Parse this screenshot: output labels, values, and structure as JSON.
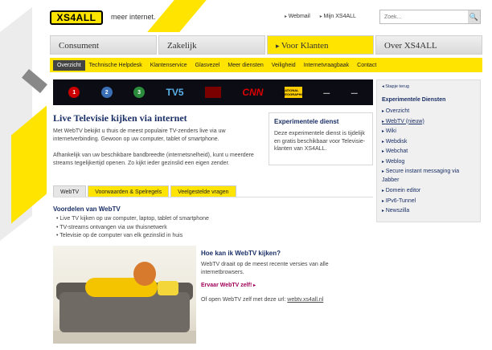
{
  "header": {
    "logo": "XS4ALL",
    "tagline": "meer internet.",
    "links": [
      "Webmail",
      "Mijn XS4ALL"
    ],
    "search_placeholder": "Zoek..."
  },
  "main_tabs": [
    "Consument",
    "Zakelijk",
    "Voor Klanten",
    "Over XS4ALL"
  ],
  "subnav": [
    "Overzicht",
    "Technische Helpdesk",
    "Klantenservice",
    "Glasvezel",
    "Meer diensten",
    "Veiligheid",
    "Internetvraagbaak",
    "Contact"
  ],
  "banner": {
    "channels": [
      "1",
      "2",
      "3",
      "TV5",
      "CNN",
      "NATIONAL GEOGRAPHIC"
    ]
  },
  "content": {
    "title": "Live Televisie kijken via internet",
    "intro_1": "Met WebTV bekijkt u thuis de meest populaire TV-zenders live via uw internetverbinding. Gewoon op uw computer, tablet of smartphone.",
    "intro_2": "Afhankelijk van uw beschikbare bandbreedte (internetsnelheid), kunt u meerdere streams tegelijkertijd openen. Zo kijkt ieder gezinslid een eigen zender.",
    "tabs": [
      "WebTV",
      "Voorwaarden & Spelregels",
      "Veelgestelde vragen"
    ],
    "advantages_title": "Voordelen van WebTV",
    "advantages": [
      "Live TV kijken op uw computer, laptop, tablet of smartphone",
      "TV-streams ontvangen via uw thuisnetwerk",
      "Televisie op de computer van elk gezinslid in huis"
    ],
    "how_title": "Hoe kan ik WebTV kijken?",
    "how_text": "WebTV draait op de meest recente versies van alle internetbrowsers.",
    "try_link": "Ervaar WebTV zelf!",
    "open_text": "Of open WebTV zelf met deze url:",
    "open_url": "webtv.xs4all.nl"
  },
  "experimental": {
    "title": "Experimentele dienst",
    "text": "Deze experimentele dienst is tijdelijk en gratis beschikbaar voor Televisie-klanten van XS4ALL."
  },
  "sidebar": {
    "back": "Stapje terug",
    "title": "Experimentele Diensten",
    "items": [
      "Overzicht",
      "WebTV (nieuw)",
      "Wiki",
      "Webdisk",
      "Webchat",
      "Weblog",
      "Secure instant messaging via Jabber",
      "Domein editor",
      "IPv6-Tunnel",
      "Newszilla"
    ]
  }
}
